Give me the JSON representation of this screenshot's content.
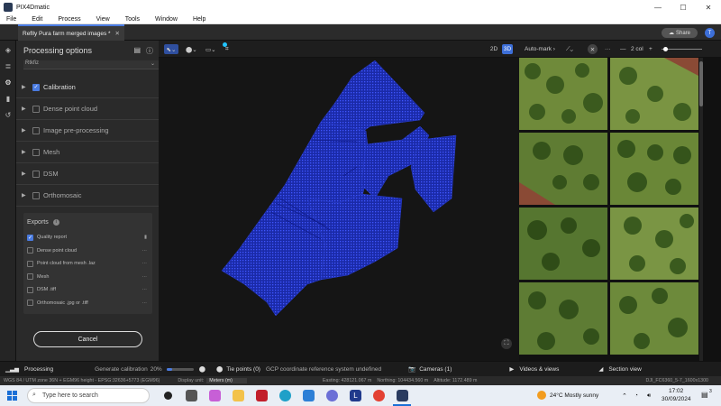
{
  "window": {
    "title": "PIX4Dmatic",
    "min": "—",
    "max": "☐",
    "close": "✕"
  },
  "menu": [
    "File",
    "Edit",
    "Process",
    "View",
    "Tools",
    "Window",
    "Help"
  ],
  "tab": {
    "label": "Reflly Pura farm merged images *",
    "close": "✕"
  },
  "header_right": {
    "share_label": "Share",
    "avatar_letter": "T"
  },
  "panel": {
    "title": "Processing options",
    "dropdown_value": "Rtkfiz",
    "sections": [
      {
        "label": "Calibration",
        "checked": true
      },
      {
        "label": "Dense point cloud",
        "checked": false
      },
      {
        "label": "Image pre-processing",
        "checked": false
      },
      {
        "label": "Mesh",
        "checked": false
      },
      {
        "label": "DSM",
        "checked": false
      },
      {
        "label": "Orthomosaic",
        "checked": false
      }
    ],
    "exports_title": "Exports",
    "exports": [
      {
        "label": "Quality report",
        "checked": true,
        "action": "▮"
      },
      {
        "label": "Dense point cloud",
        "checked": false,
        "action": "···"
      },
      {
        "label": "Point cloud from mesh .laz",
        "checked": false,
        "action": "···"
      },
      {
        "label": "Mesh",
        "checked": false,
        "action": "···"
      },
      {
        "label": "DSM .tiff",
        "checked": false,
        "action": "···"
      },
      {
        "label": "Orthomosaic .jpg or .tiff",
        "checked": false,
        "action": "···"
      }
    ],
    "cancel_label": "Cancel"
  },
  "viewport_tools": {
    "mode_2d": "2D",
    "mode_3d": "3D"
  },
  "image_tools": {
    "automark": "Auto-mark",
    "cols": "2 col"
  },
  "status": {
    "processing": "Processing",
    "generate": "Generate calibration",
    "progress_pct": "20%",
    "progress_fraction": 0.2,
    "tie_points": "Tie points (0)",
    "gcp_msg": "GCP coordinate reference system undefined",
    "cameras": "Cameras (1)",
    "videos": "Videos & views",
    "section_view": "Section view"
  },
  "coords": {
    "crs": "WGS 84 / UTM zone 36N + EGM96 height - EPSG:32636+5773 (EGM96)",
    "display_unit_label": "Display unit:",
    "display_unit": "Meters (m)",
    "easting": "Easting: 428121.067 m",
    "northing": "Northing: 104434.560 m",
    "altitude": "Altitude: 1172.489 m",
    "image": "DJI_FC6360_5-7_1600x1300"
  },
  "taskbar": {
    "search_placeholder": "Type here to search",
    "weather": "24°C  Mostly sunny",
    "time": "17:02",
    "date": "30/09/2024",
    "notif": "3"
  },
  "colors": {
    "accent": "#4a7be0",
    "points": "#2a3fd0",
    "panel": "#2a2a2a"
  }
}
